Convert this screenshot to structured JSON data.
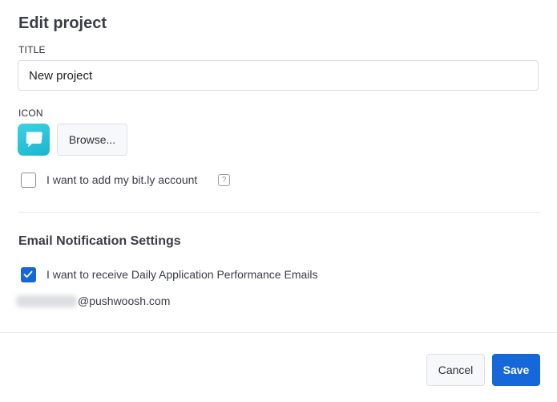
{
  "dialog": {
    "title": "Edit project"
  },
  "title_field": {
    "label": "TITLE",
    "value": "New project"
  },
  "icon_field": {
    "label": "ICON",
    "icon": "chat-bubble-icon",
    "browse_label": "Browse..."
  },
  "bitly": {
    "label": "I want to add my bit.ly account",
    "checked": false,
    "help_icon": "question-icon",
    "help_glyph": "?"
  },
  "email_section": {
    "title": "Email Notification Settings",
    "daily_label": "I want to receive Daily Application Performance Emails",
    "daily_checked": true,
    "email_domain": "@pushwoosh.com"
  },
  "footer": {
    "cancel_label": "Cancel",
    "save_label": "Save"
  },
  "colors": {
    "primary": "#1667d9",
    "icon_gradient_start": "#3fd0e3",
    "icon_gradient_end": "#19b6d0",
    "divider": "#e6e8eb"
  }
}
